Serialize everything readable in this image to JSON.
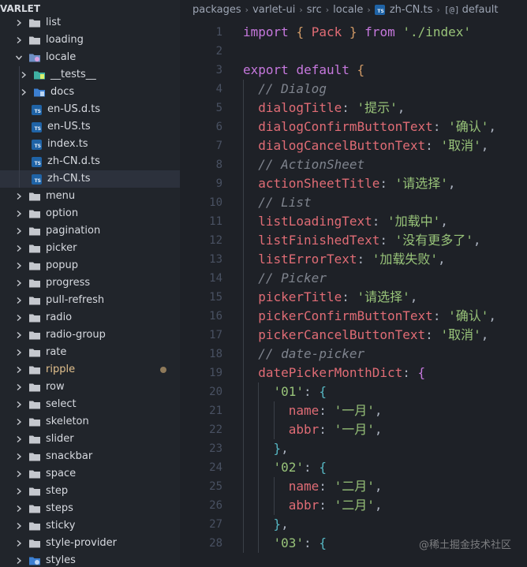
{
  "sidebar": {
    "root_label": "VARLET",
    "items": [
      {
        "label": "list",
        "type": "folder",
        "expanded": false,
        "depth": 0
      },
      {
        "label": "loading",
        "type": "folder",
        "expanded": false,
        "depth": 0
      },
      {
        "label": "locale",
        "type": "folder-locale",
        "expanded": true,
        "depth": 0
      },
      {
        "label": "__tests__",
        "type": "folder-test",
        "expanded": false,
        "depth": 1
      },
      {
        "label": "docs",
        "type": "folder-docs",
        "expanded": false,
        "depth": 1
      },
      {
        "label": "en-US.d.ts",
        "type": "ts",
        "depth": 1
      },
      {
        "label": "en-US.ts",
        "type": "ts",
        "depth": 1
      },
      {
        "label": "index.ts",
        "type": "ts",
        "depth": 1
      },
      {
        "label": "zh-CN.d.ts",
        "type": "ts",
        "depth": 1
      },
      {
        "label": "zh-CN.ts",
        "type": "ts",
        "depth": 1,
        "selected": true
      },
      {
        "label": "menu",
        "type": "folder",
        "expanded": false,
        "depth": 0
      },
      {
        "label": "option",
        "type": "folder",
        "expanded": false,
        "depth": 0
      },
      {
        "label": "pagination",
        "type": "folder",
        "expanded": false,
        "depth": 0
      },
      {
        "label": "picker",
        "type": "folder",
        "expanded": false,
        "depth": 0
      },
      {
        "label": "popup",
        "type": "folder",
        "expanded": false,
        "depth": 0
      },
      {
        "label": "progress",
        "type": "folder",
        "expanded": false,
        "depth": 0
      },
      {
        "label": "pull-refresh",
        "type": "folder",
        "expanded": false,
        "depth": 0
      },
      {
        "label": "radio",
        "type": "folder",
        "expanded": false,
        "depth": 0
      },
      {
        "label": "radio-group",
        "type": "folder",
        "expanded": false,
        "depth": 0
      },
      {
        "label": "rate",
        "type": "folder",
        "expanded": false,
        "depth": 0
      },
      {
        "label": "ripple",
        "type": "folder",
        "expanded": false,
        "depth": 0,
        "modified": true
      },
      {
        "label": "row",
        "type": "folder",
        "expanded": false,
        "depth": 0
      },
      {
        "label": "select",
        "type": "folder",
        "expanded": false,
        "depth": 0
      },
      {
        "label": "skeleton",
        "type": "folder",
        "expanded": false,
        "depth": 0
      },
      {
        "label": "slider",
        "type": "folder",
        "expanded": false,
        "depth": 0
      },
      {
        "label": "snackbar",
        "type": "folder",
        "expanded": false,
        "depth": 0
      },
      {
        "label": "space",
        "type": "folder",
        "expanded": false,
        "depth": 0
      },
      {
        "label": "step",
        "type": "folder",
        "expanded": false,
        "depth": 0
      },
      {
        "label": "steps",
        "type": "folder",
        "expanded": false,
        "depth": 0
      },
      {
        "label": "sticky",
        "type": "folder",
        "expanded": false,
        "depth": 0
      },
      {
        "label": "style-provider",
        "type": "folder",
        "expanded": false,
        "depth": 0
      },
      {
        "label": "styles",
        "type": "folder-styles",
        "expanded": false,
        "depth": 0
      }
    ]
  },
  "breadcrumb": {
    "parts": [
      "packages",
      "varlet-ui",
      "src",
      "locale"
    ],
    "file": "zh-CN.ts",
    "file_badge": "TS",
    "symbol": "default",
    "symbol_icon": "[@]"
  },
  "editor": {
    "lines": [
      {
        "n": "1",
        "indent": 0,
        "tokens": [
          [
            "kw",
            "import"
          ],
          [
            "pun",
            " "
          ],
          [
            "br1",
            "{"
          ],
          [
            "pun",
            " "
          ],
          [
            "imp",
            "Pack"
          ],
          [
            "pun",
            " "
          ],
          [
            "br1",
            "}"
          ],
          [
            "pun",
            " "
          ],
          [
            "kw",
            "from"
          ],
          [
            "pun",
            " "
          ],
          [
            "str",
            "'./index'"
          ]
        ]
      },
      {
        "n": "2",
        "indent": 0,
        "tokens": []
      },
      {
        "n": "3",
        "indent": 0,
        "tokens": [
          [
            "kw",
            "export"
          ],
          [
            "pun",
            " "
          ],
          [
            "kw",
            "default"
          ],
          [
            "pun",
            " "
          ],
          [
            "br1",
            "{"
          ]
        ]
      },
      {
        "n": "4",
        "indent": 1,
        "tokens": [
          [
            "cmt",
            "// Dialog"
          ]
        ]
      },
      {
        "n": "5",
        "indent": 1,
        "tokens": [
          [
            "prop",
            "dialogTitle"
          ],
          [
            "pun",
            ": "
          ],
          [
            "str",
            "'提示'"
          ],
          [
            "pun",
            ","
          ]
        ]
      },
      {
        "n": "6",
        "indent": 1,
        "tokens": [
          [
            "prop",
            "dialogConfirmButtonText"
          ],
          [
            "pun",
            ": "
          ],
          [
            "str",
            "'确认'"
          ],
          [
            "pun",
            ","
          ]
        ]
      },
      {
        "n": "7",
        "indent": 1,
        "tokens": [
          [
            "prop",
            "dialogCancelButtonText"
          ],
          [
            "pun",
            ": "
          ],
          [
            "str",
            "'取消'"
          ],
          [
            "pun",
            ","
          ]
        ]
      },
      {
        "n": "8",
        "indent": 1,
        "tokens": [
          [
            "cmt",
            "// ActionSheet"
          ]
        ]
      },
      {
        "n": "9",
        "indent": 1,
        "tokens": [
          [
            "prop",
            "actionSheetTitle"
          ],
          [
            "pun",
            ": "
          ],
          [
            "str",
            "'请选择'"
          ],
          [
            "pun",
            ","
          ]
        ]
      },
      {
        "n": "10",
        "indent": 1,
        "tokens": [
          [
            "cmt",
            "// List"
          ]
        ]
      },
      {
        "n": "11",
        "indent": 1,
        "tokens": [
          [
            "prop",
            "listLoadingText"
          ],
          [
            "pun",
            ": "
          ],
          [
            "str",
            "'加载中'"
          ],
          [
            "pun",
            ","
          ]
        ]
      },
      {
        "n": "12",
        "indent": 1,
        "tokens": [
          [
            "prop",
            "listFinishedText"
          ],
          [
            "pun",
            ": "
          ],
          [
            "str",
            "'没有更多了'"
          ],
          [
            "pun",
            ","
          ]
        ]
      },
      {
        "n": "13",
        "indent": 1,
        "tokens": [
          [
            "prop",
            "listErrorText"
          ],
          [
            "pun",
            ": "
          ],
          [
            "str",
            "'加载失败'"
          ],
          [
            "pun",
            ","
          ]
        ]
      },
      {
        "n": "14",
        "indent": 1,
        "tokens": [
          [
            "cmt",
            "// Picker"
          ]
        ]
      },
      {
        "n": "15",
        "indent": 1,
        "tokens": [
          [
            "prop",
            "pickerTitle"
          ],
          [
            "pun",
            ": "
          ],
          [
            "str",
            "'请选择'"
          ],
          [
            "pun",
            ","
          ]
        ]
      },
      {
        "n": "16",
        "indent": 1,
        "tokens": [
          [
            "prop",
            "pickerConfirmButtonText"
          ],
          [
            "pun",
            ": "
          ],
          [
            "str",
            "'确认'"
          ],
          [
            "pun",
            ","
          ]
        ]
      },
      {
        "n": "17",
        "indent": 1,
        "tokens": [
          [
            "prop",
            "pickerCancelButtonText"
          ],
          [
            "pun",
            ": "
          ],
          [
            "str",
            "'取消'"
          ],
          [
            "pun",
            ","
          ]
        ]
      },
      {
        "n": "18",
        "indent": 1,
        "tokens": [
          [
            "cmt",
            "// date-picker"
          ]
        ]
      },
      {
        "n": "19",
        "indent": 1,
        "tokens": [
          [
            "prop",
            "datePickerMonthDict"
          ],
          [
            "pun",
            ": "
          ],
          [
            "br2",
            "{"
          ]
        ]
      },
      {
        "n": "20",
        "indent": 2,
        "tokens": [
          [
            "str",
            "'01'"
          ],
          [
            "pun",
            ": "
          ],
          [
            "br3",
            "{"
          ]
        ]
      },
      {
        "n": "21",
        "indent": 3,
        "tokens": [
          [
            "prop",
            "name"
          ],
          [
            "pun",
            ": "
          ],
          [
            "str",
            "'一月'"
          ],
          [
            "pun",
            ","
          ]
        ]
      },
      {
        "n": "22",
        "indent": 3,
        "tokens": [
          [
            "prop",
            "abbr"
          ],
          [
            "pun",
            ": "
          ],
          [
            "str",
            "'一月'"
          ],
          [
            "pun",
            ","
          ]
        ]
      },
      {
        "n": "23",
        "indent": 2,
        "tokens": [
          [
            "br3",
            "}"
          ],
          [
            "pun",
            ","
          ]
        ]
      },
      {
        "n": "24",
        "indent": 2,
        "tokens": [
          [
            "str",
            "'02'"
          ],
          [
            "pun",
            ": "
          ],
          [
            "br3",
            "{"
          ]
        ]
      },
      {
        "n": "25",
        "indent": 3,
        "tokens": [
          [
            "prop",
            "name"
          ],
          [
            "pun",
            ": "
          ],
          [
            "str",
            "'二月'"
          ],
          [
            "pun",
            ","
          ]
        ]
      },
      {
        "n": "26",
        "indent": 3,
        "tokens": [
          [
            "prop",
            "abbr"
          ],
          [
            "pun",
            ": "
          ],
          [
            "str",
            "'二月'"
          ],
          [
            "pun",
            ","
          ]
        ]
      },
      {
        "n": "27",
        "indent": 2,
        "tokens": [
          [
            "br3",
            "}"
          ],
          [
            "pun",
            ","
          ]
        ]
      },
      {
        "n": "28",
        "indent": 2,
        "tokens": [
          [
            "str",
            "'03'"
          ],
          [
            "pun",
            ": "
          ],
          [
            "br3",
            "{"
          ]
        ]
      }
    ]
  },
  "watermark": "@稀土掘金技术社区",
  "colors": {
    "sidebar_bg": "#21252b",
    "editor_bg": "#1e2127",
    "keyword": "#c678dd",
    "string": "#98c379",
    "property": "#e06c75",
    "comment": "#7f848e",
    "modified": "#e2c08d",
    "ts_badge": "#1f63a6"
  }
}
